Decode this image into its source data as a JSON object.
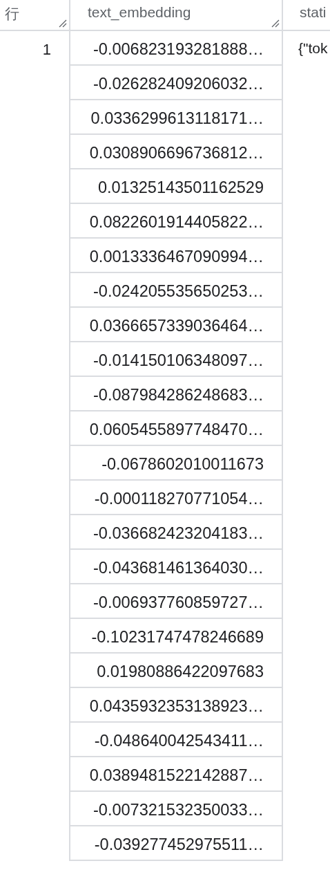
{
  "table": {
    "columns": [
      {
        "label": "行"
      },
      {
        "label": "text_embedding"
      },
      {
        "label": "stati"
      }
    ],
    "rows": [
      {
        "row_number": "1",
        "status": "{\"tok",
        "text_embedding": [
          "-0.006823193281888…",
          "-0.026282409206032…",
          "0.0336299613118171…",
          "0.0308906696736812…",
          "0.01325143501162529",
          "0.0822601914405822…",
          "0.0013336467090994…",
          "-0.024205535650253…",
          "0.0366657339036464…",
          "-0.014150106348097…",
          "-0.087984286248683…",
          "0.0605455897748470…",
          "-0.0678602010011673",
          "-0.000118270771054…",
          "-0.036682423204183…",
          "-0.043681461364030…",
          "-0.006937760859727…",
          "-0.10231747478246689",
          "0.01980886422097683",
          "0.0435932353138923…",
          "-0.048640042543411…",
          "0.0389481522142887…",
          "-0.007321532350033…",
          "-0.039277452975511…"
        ]
      }
    ]
  }
}
